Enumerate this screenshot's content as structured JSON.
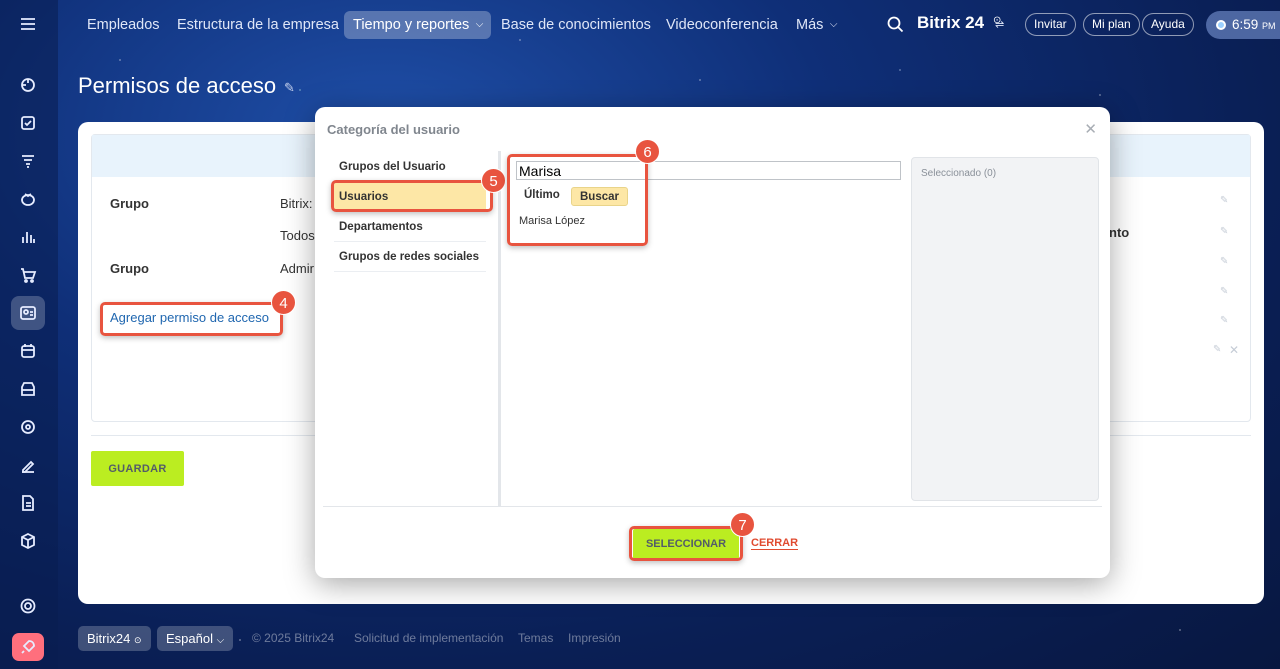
{
  "nav": {
    "items": [
      "Empleados",
      "Estructura de la empresa",
      "Tiempo y reportes",
      "Base de conocimientos",
      "Videoconferencia",
      "Más"
    ],
    "brand": "Bitrix 24",
    "invite": "Invitar",
    "plan": "Mi plan",
    "help": "Ayuda",
    "clock": "6:59",
    "clock_suffix": "PM"
  },
  "page": {
    "title": "Permisos de acceso"
  },
  "table": {
    "rows": [
      {
        "label": "Grupo",
        "value": "Bitrix:"
      },
      {
        "label": "",
        "value": "Todos"
      },
      {
        "label": "Grupo",
        "value": "Admir"
      }
    ],
    "right_fragment": "nto",
    "add_link": "Agregar permiso de acceso",
    "save": "GUARDAR"
  },
  "modal": {
    "title": "Categoría del usuario",
    "categories": [
      "Grupos del Usuario",
      "Usuarios",
      "Departamentos",
      "Grupos de redes sociales"
    ],
    "search_value": "Marisa",
    "tab_last": "Último",
    "tab_search": "Buscar",
    "result": "Marisa López",
    "selected_label": "Seleccionado (0)",
    "select_button": "SELECCIONAR",
    "close_link": "CERRAR"
  },
  "badges": [
    "4",
    "5",
    "6",
    "7"
  ],
  "footer": {
    "brand": "Bitrix24",
    "language": "Español",
    "copyright": "© 2025 Bitrix24",
    "links": [
      "Solicitud de implementación",
      "Temas",
      "Impresión"
    ]
  },
  "colors": {
    "accent_green": "#bbed21",
    "annotation_red": "#e8543f",
    "highlight_yellow": "#fde7a6"
  }
}
